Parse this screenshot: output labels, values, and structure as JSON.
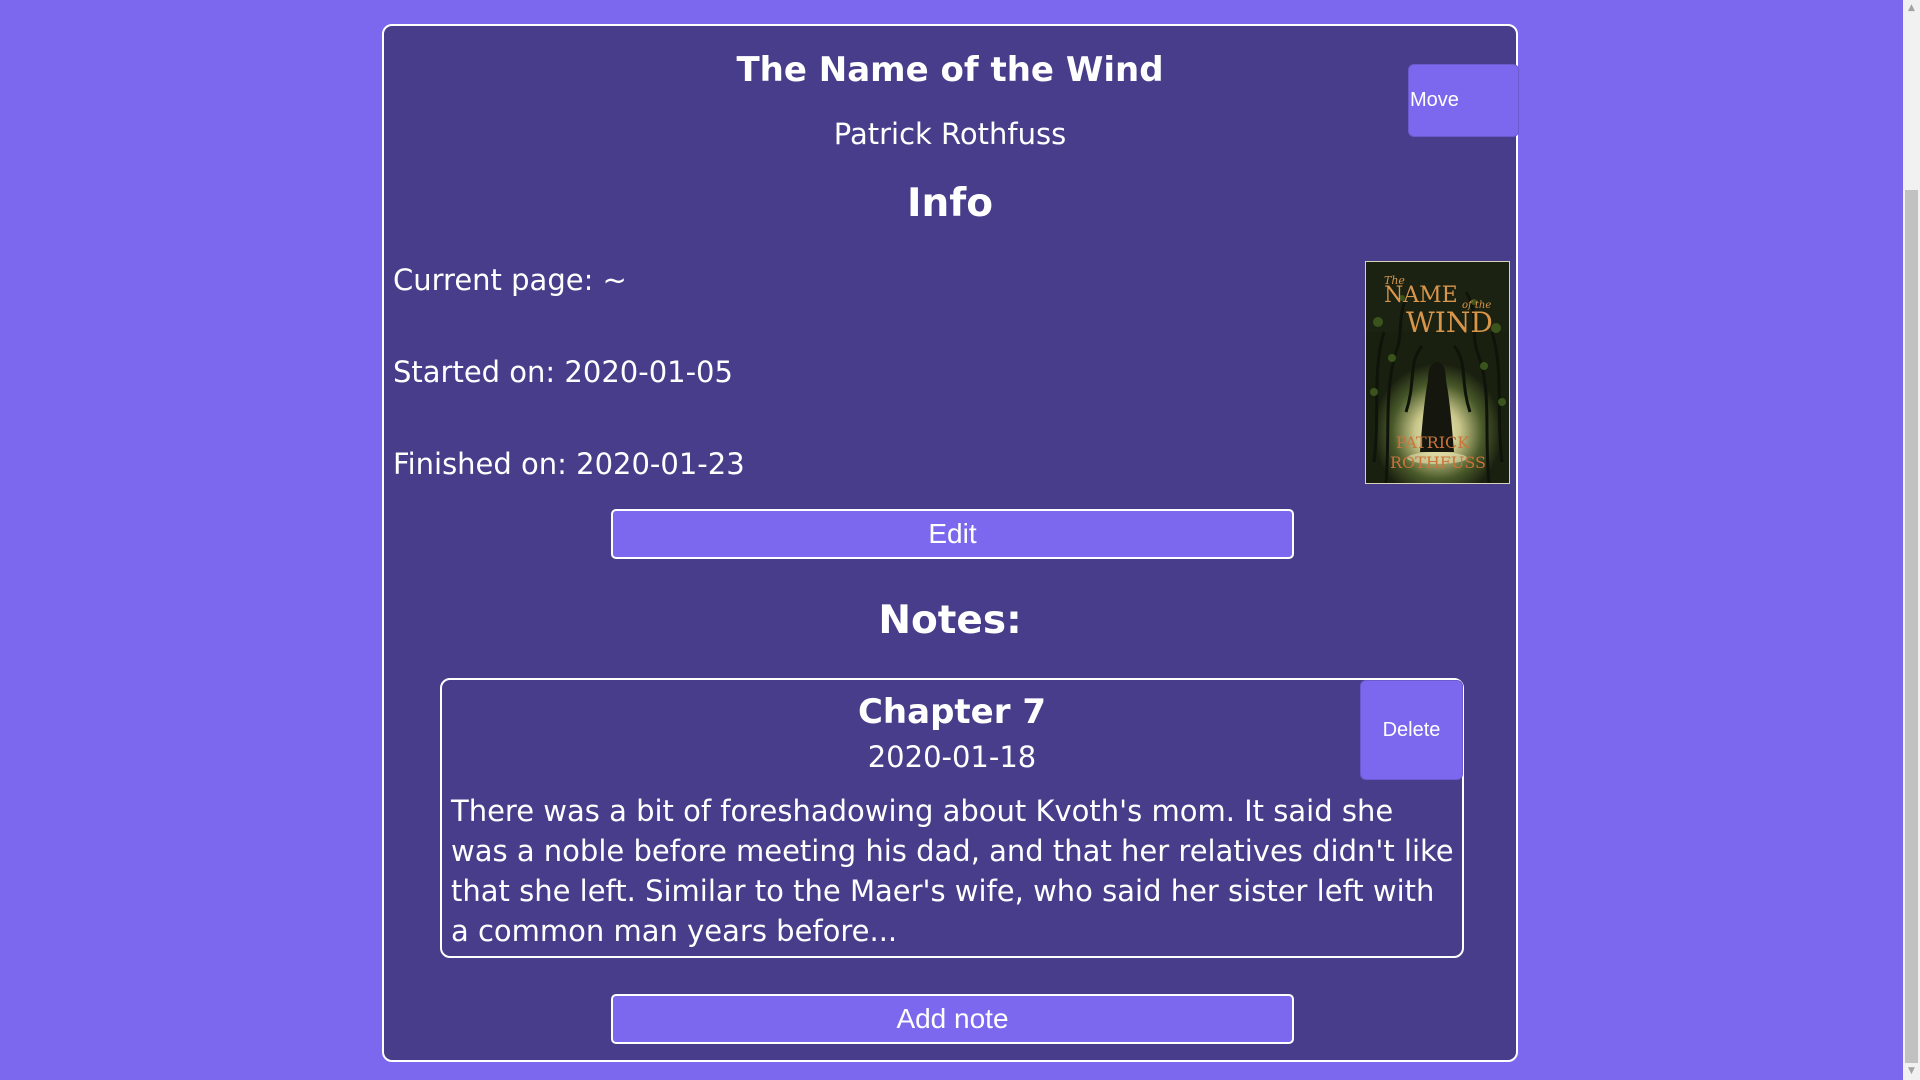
{
  "colors": {
    "page_background": "#7b68ee",
    "card_background": "#483d8b",
    "button_background": "#7b68ee",
    "border": "#ffffff",
    "text": "#ffffff"
  },
  "book": {
    "title": "The Name of the Wind",
    "author": "Patrick Rothfuss",
    "move_label": "Move",
    "cover": {
      "title_line1": "The",
      "title_line2": "NAME",
      "title_line3": "of the",
      "title_line4": "WIND",
      "author_line1": "PATRICK",
      "author_line2": "ROTHFUSS"
    }
  },
  "info": {
    "heading": "Info",
    "current_page": "Current page: ~",
    "started_on": "Started on: 2020-01-05",
    "finished_on": "Finished on: 2020-01-23",
    "edit_label": "Edit"
  },
  "notes": {
    "heading": "Notes:",
    "items": [
      {
        "title": "Chapter 7",
        "date": "2020-01-18",
        "delete_label": "Delete",
        "body": "There was a bit of foreshadowing about Kvoth's mom. It said she was a noble before meeting his dad, and that her relatives didn't like that she left. Similar to the Maer's wife, who said her sister left with a common man years before..."
      }
    ],
    "add_label": "Add note"
  },
  "scrollbar": {
    "up_icon": "scroll-up-arrow-icon",
    "down_icon": "scroll-down-arrow-icon"
  }
}
